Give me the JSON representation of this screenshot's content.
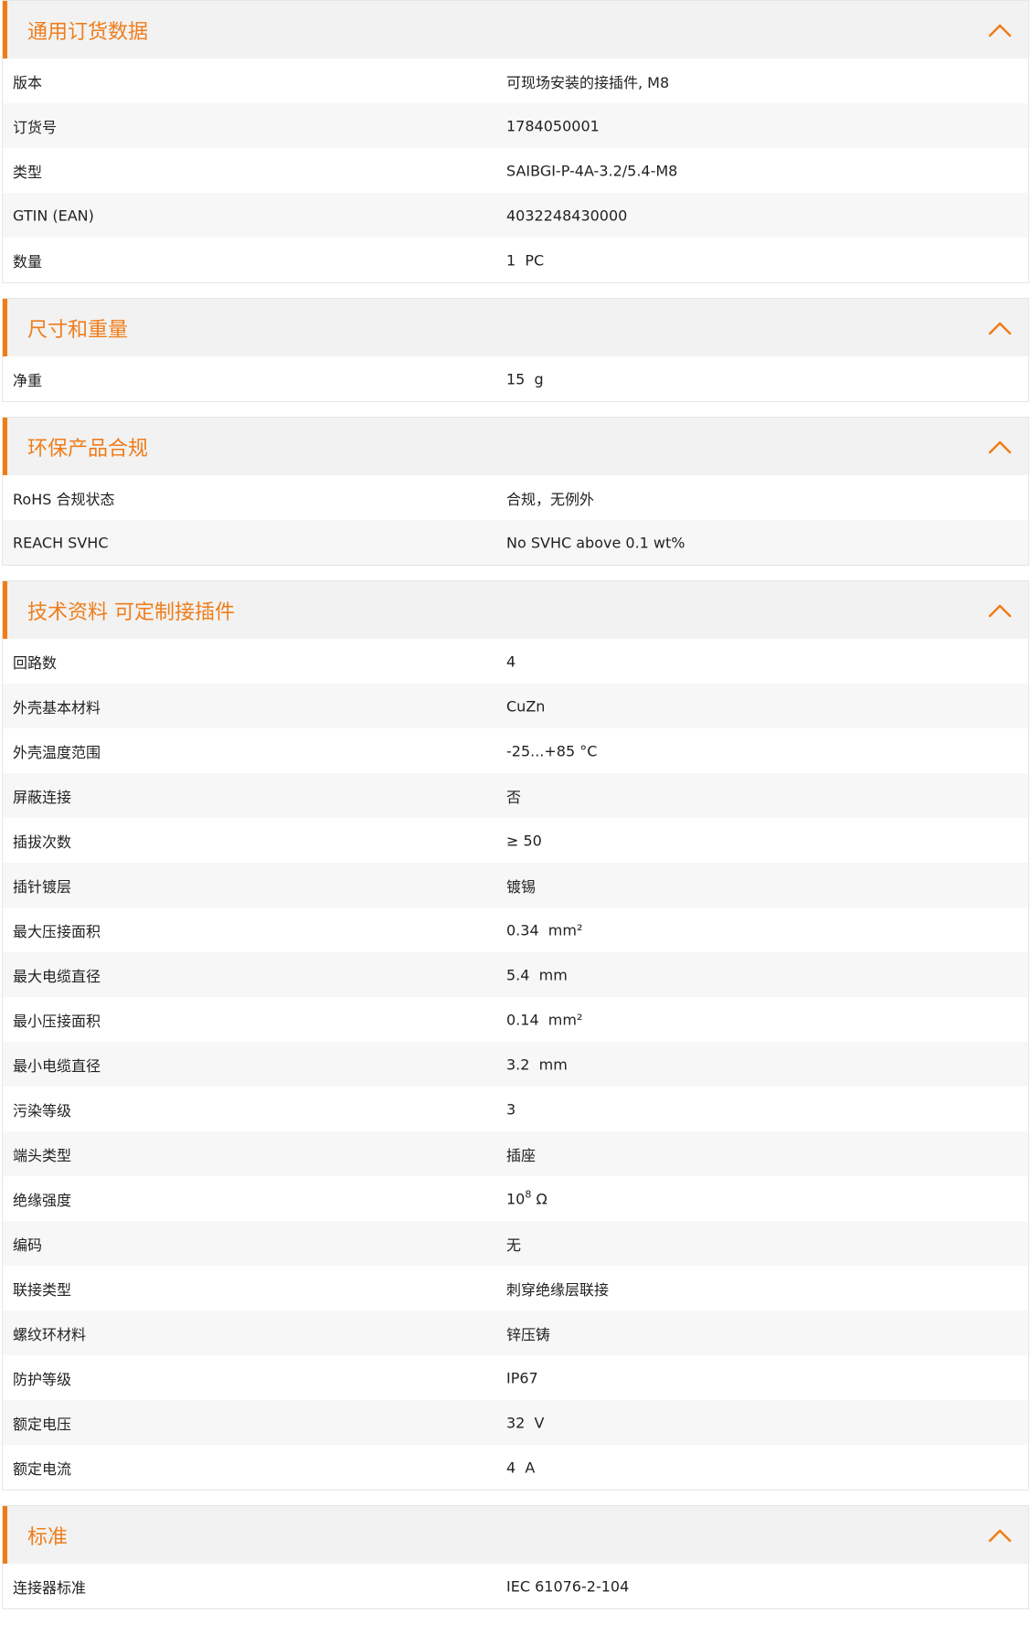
{
  "colors": {
    "accent": "#f07d14",
    "title_text": "#ef7d1b",
    "header_bg": "#f2f2f2",
    "row_alt_bg": "#f7f7f7",
    "border": "#e6e6e6"
  },
  "icons": {
    "collapse": "chevron-up-icon"
  },
  "sections": [
    {
      "title": "通用订货数据",
      "expanded": true,
      "rows": [
        {
          "label": "版本",
          "value": "可现场安装的接插件, M8"
        },
        {
          "label": "订货号",
          "value": "1784050001"
        },
        {
          "label": "类型",
          "value": "SAIBGI-P-4A-3.2/5.4-M8"
        },
        {
          "label": "GTIN (EAN)",
          "value": "4032248430000"
        },
        {
          "label": "数量",
          "value": "1  PC"
        }
      ]
    },
    {
      "title": "尺寸和重量",
      "expanded": true,
      "rows": [
        {
          "label": "净重",
          "value": "15  g"
        }
      ]
    },
    {
      "title": "环保产品合规",
      "expanded": true,
      "rows": [
        {
          "label": "RoHS 合规状态",
          "value": "合规，无例外"
        },
        {
          "label": "REACH SVHC",
          "value": "No SVHC above 0.1 wt%"
        }
      ]
    },
    {
      "title": "技术资料 可定制接插件",
      "expanded": true,
      "rows": [
        {
          "label": "回路数",
          "value": "4"
        },
        {
          "label": "外壳基本材料",
          "value": "CuZn"
        },
        {
          "label": "外壳温度范围",
          "value": "-25...+85 °C"
        },
        {
          "label": "屏蔽连接",
          "value": "否"
        },
        {
          "label": "插拔次数",
          "value": "≥ 50"
        },
        {
          "label": "插针镀层",
          "value": "镀锡"
        },
        {
          "label": "最大压接面积",
          "value": "0.34  mm²"
        },
        {
          "label": "最大电缆直径",
          "value": "5.4  mm"
        },
        {
          "label": "最小压接面积",
          "value": "0.14  mm²"
        },
        {
          "label": "最小电缆直径",
          "value": "3.2  mm"
        },
        {
          "label": "污染等级",
          "value": "3"
        },
        {
          "label": "端头类型",
          "value": "插座"
        },
        {
          "label": "绝缘强度",
          "value": "10",
          "sup": "8",
          "unit": " Ω"
        },
        {
          "label": "编码",
          "value": "无"
        },
        {
          "label": "联接类型",
          "value": "刺穿绝缘层联接"
        },
        {
          "label": "螺纹环材料",
          "value": "锌压铸"
        },
        {
          "label": "防护等级",
          "value": "IP67"
        },
        {
          "label": "额定电压",
          "value": "32  V"
        },
        {
          "label": "额定电流",
          "value": "4  A"
        }
      ]
    },
    {
      "title": "标准",
      "expanded": true,
      "rows": [
        {
          "label": "连接器标准",
          "value": "IEC 61076-2-104"
        }
      ]
    }
  ]
}
